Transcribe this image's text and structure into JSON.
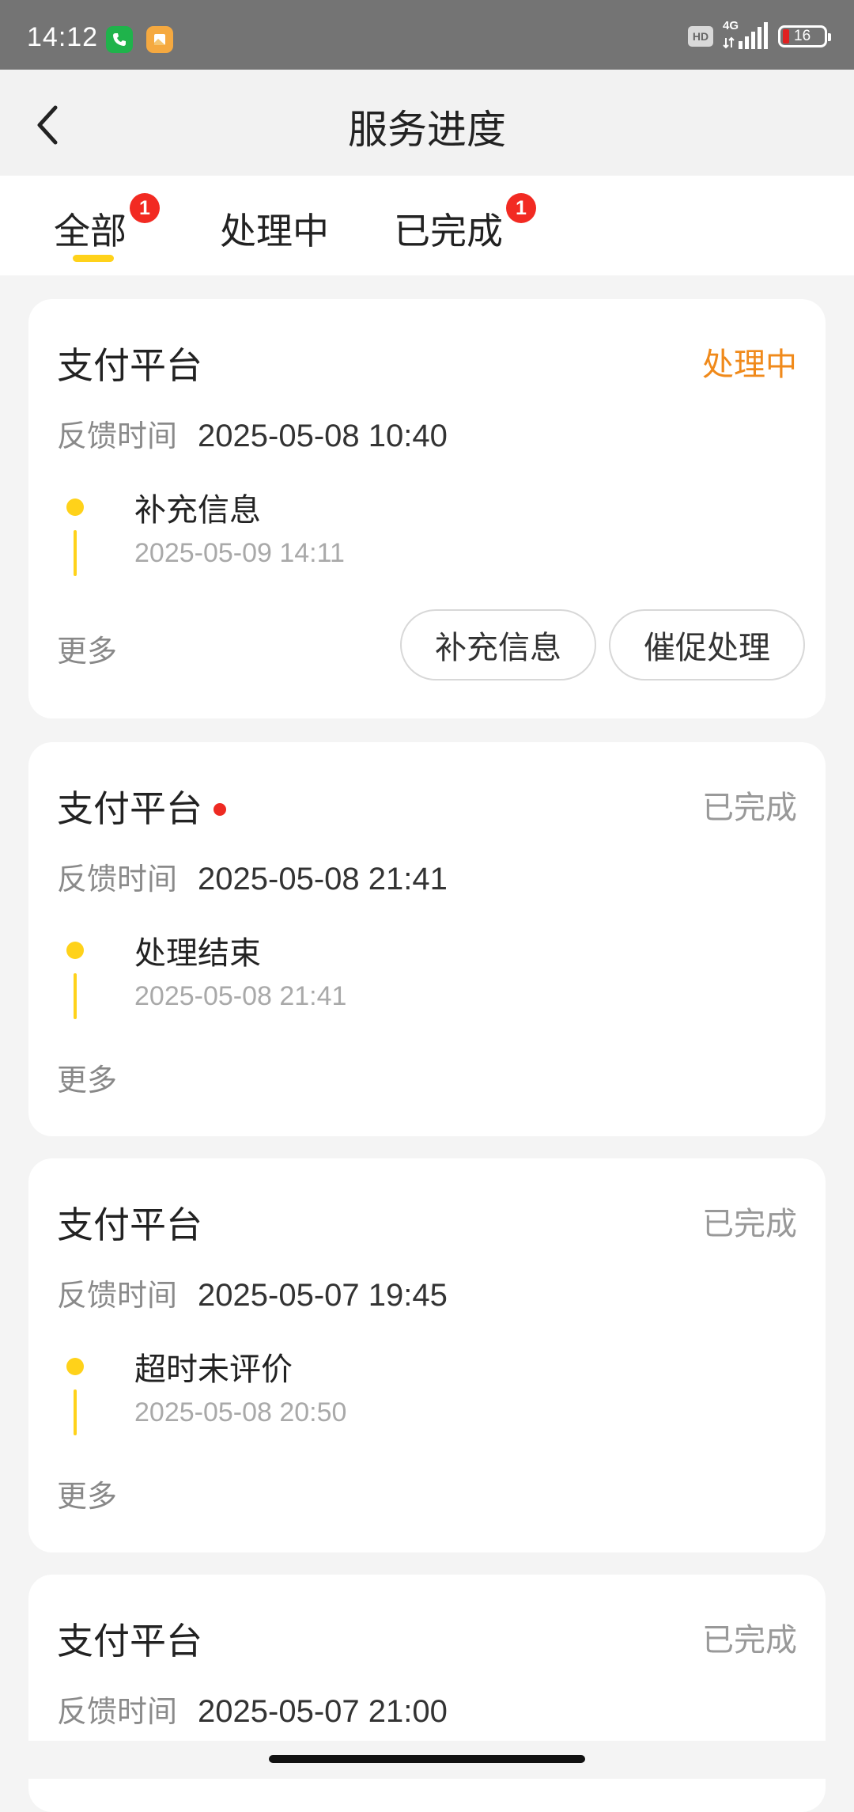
{
  "status_bar": {
    "time": "14:12",
    "network": "4G",
    "hd": "HD",
    "battery": "16",
    "icons": [
      "phone-app-icon",
      "gallery-app-icon",
      "hd-icon",
      "signal-icon",
      "battery-icon"
    ]
  },
  "header": {
    "title": "服务进度",
    "back_icon": "chevron-left-icon"
  },
  "tabs": [
    {
      "label": "全部",
      "badge": "1",
      "active": true
    },
    {
      "label": "处理中",
      "badge": "",
      "active": false
    },
    {
      "label": "已完成",
      "badge": "1",
      "active": false
    }
  ],
  "colors": {
    "accent_yellow": "#ffd21a",
    "status_processing": "#f08a1b",
    "status_done": "#999999",
    "badge_red": "#f22a22"
  },
  "cards": [
    {
      "title": "支付平台",
      "status": "处理中",
      "feedback_label": "反馈时间",
      "feedback_time": "2025-05-08 10:40",
      "timeline_title": "补充信息",
      "timeline_time": "2025-05-09 14:11",
      "more": "更多",
      "actions": [
        "补充信息",
        "催促处理"
      ]
    },
    {
      "title": "支付平台",
      "status": "已完成",
      "unread": true,
      "feedback_label": "反馈时间",
      "feedback_time": "2025-05-08 21:41",
      "timeline_title": "处理结束",
      "timeline_time": "2025-05-08 21:41",
      "more": "更多"
    },
    {
      "title": "支付平台",
      "status": "已完成",
      "feedback_label": "反馈时间",
      "feedback_time": "2025-05-07 19:45",
      "timeline_title": "超时未评价",
      "timeline_time": "2025-05-08 20:50",
      "more": "更多"
    },
    {
      "title": "支付平台",
      "status": "已完成",
      "feedback_label": "反馈时间",
      "feedback_time": "2025-05-07 21:00"
    }
  ]
}
